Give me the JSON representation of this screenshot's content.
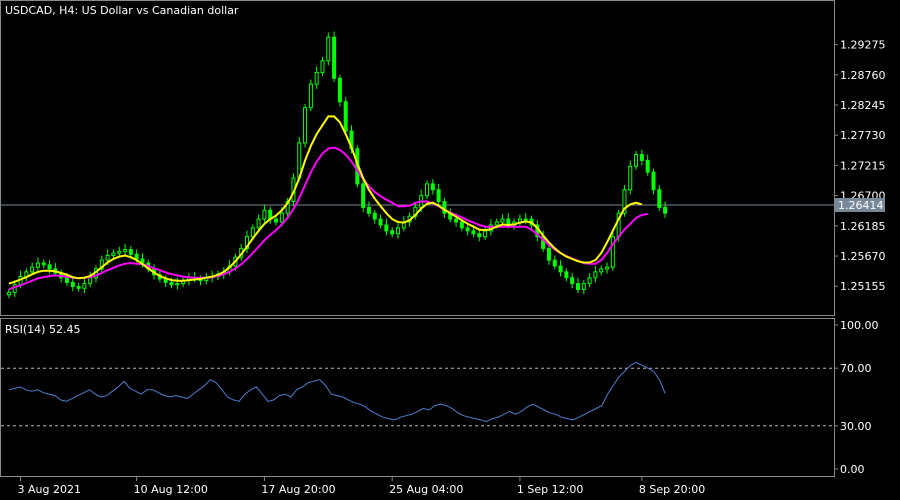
{
  "chart_data": [
    {
      "type": "candlestick",
      "title": "USDCAD, H4:  US Dollar vs Canadian dollar",
      "ylim": [
        1.2475,
        1.2995
      ],
      "y_ticks": [
        "1.29275",
        "1.28760",
        "1.28245",
        "1.27730",
        "1.27215",
        "1.26700",
        "1.26185",
        "1.25670",
        "1.25155"
      ],
      "current_price": "1.26414",
      "x_ticks": [
        "3 Aug 2021",
        "10 Aug 12:00",
        "17 Aug 20:00",
        "25 Aug 04:00",
        "1 Sep 12:00",
        "8 Sep 20:00"
      ],
      "colors": {
        "candle": "#00ff00",
        "ma_fast": "#ffff00",
        "ma_slow": "#ff00ff",
        "price_line": "#778899"
      },
      "closes": [
        1.2505,
        1.2518,
        1.2532,
        1.254,
        1.2548,
        1.2555,
        1.2552,
        1.2545,
        1.2538,
        1.253,
        1.2522,
        1.2515,
        1.2512,
        1.252,
        1.253,
        1.2545,
        1.256,
        1.2568,
        1.2572,
        1.2575,
        1.2578,
        1.257,
        1.2562,
        1.2555,
        1.2545,
        1.2535,
        1.2528,
        1.2522,
        1.2518,
        1.252,
        1.2525,
        1.253,
        1.2528,
        1.2525,
        1.253,
        1.2532,
        1.2536,
        1.254,
        1.255,
        1.2565,
        1.258,
        1.26,
        1.2615,
        1.263,
        1.2645,
        1.263,
        1.2625,
        1.264,
        1.266,
        1.27,
        1.276,
        1.282,
        1.286,
        1.288,
        1.29,
        1.294,
        1.287,
        1.283,
        1.278,
        1.275,
        1.269,
        1.265,
        1.264,
        1.263,
        1.262,
        1.261,
        1.2605,
        1.2615,
        1.2625,
        1.2635,
        1.265,
        1.267,
        1.269,
        1.268,
        1.266,
        1.264,
        1.263,
        1.2625,
        1.2615,
        1.261,
        1.2605,
        1.26,
        1.261,
        1.262,
        1.2625,
        1.263,
        1.262,
        1.2625,
        1.263,
        1.263,
        1.262,
        1.26,
        1.258,
        1.256,
        1.255,
        1.254,
        1.253,
        1.252,
        1.251,
        1.252,
        1.253,
        1.254,
        1.2545,
        1.2548,
        1.26,
        1.264,
        1.268,
        1.272,
        1.274,
        1.273,
        1.271,
        1.268,
        1.265,
        1.264
      ],
      "ma_fast": [
        1.252,
        1.2523,
        1.2527,
        1.2531,
        1.2536,
        1.254,
        1.2542,
        1.2542,
        1.2541,
        1.2538,
        1.2535,
        1.2531,
        1.2529,
        1.253,
        1.2533,
        1.254,
        1.2548,
        1.2556,
        1.2562,
        1.2566,
        1.2568,
        1.2565,
        1.256,
        1.2553,
        1.2546,
        1.2539,
        1.2533,
        1.2529,
        1.2526,
        1.2525,
        1.2525,
        1.2526,
        1.2527,
        1.2528,
        1.253,
        1.2532,
        1.2535,
        1.254,
        1.2548,
        1.2558,
        1.257,
        1.2583,
        1.2597,
        1.261,
        1.2622,
        1.263,
        1.2636,
        1.2645,
        1.2657,
        1.2675,
        1.27,
        1.273,
        1.2755,
        1.2775,
        1.279,
        1.2805,
        1.2805,
        1.2795,
        1.2775,
        1.2752,
        1.2725,
        1.27,
        1.268,
        1.2665,
        1.2652,
        1.264,
        1.263,
        1.2625,
        1.2624,
        1.2628,
        1.2637,
        1.2648,
        1.2656,
        1.2658,
        1.2653,
        1.2646,
        1.264,
        1.2634,
        1.2628,
        1.2622,
        1.2617,
        1.2612,
        1.2611,
        1.2613,
        1.2617,
        1.2621,
        1.262,
        1.2621,
        1.2624,
        1.2626,
        1.2624,
        1.2615,
        1.2602,
        1.259,
        1.258,
        1.2572,
        1.2566,
        1.2562,
        1.2558,
        1.2556,
        1.2556,
        1.256,
        1.2572,
        1.259,
        1.261,
        1.263,
        1.2648,
        1.2655,
        1.2658,
        1.2655
      ],
      "ma_slow": [
        1.251,
        1.2514,
        1.2517,
        1.2521,
        1.2525,
        1.2529,
        1.2531,
        1.2533,
        1.2534,
        1.2533,
        1.2532,
        1.253,
        1.2529,
        1.253,
        1.2531,
        1.2534,
        1.2538,
        1.2543,
        1.2547,
        1.2551,
        1.2554,
        1.2555,
        1.2554,
        1.2553,
        1.255,
        1.2546,
        1.2543,
        1.2539,
        1.2536,
        1.2534,
        1.2532,
        1.2531,
        1.253,
        1.253,
        1.253,
        1.2531,
        1.2533,
        1.2536,
        1.254,
        1.2546,
        1.2553,
        1.2562,
        1.2572,
        1.2583,
        1.2594,
        1.2603,
        1.2611,
        1.2621,
        1.2632,
        1.2647,
        1.2666,
        1.2688,
        1.271,
        1.2728,
        1.2742,
        1.275,
        1.2752,
        1.2748,
        1.274,
        1.2728,
        1.2713,
        1.2698,
        1.2686,
        1.2676,
        1.2669,
        1.2663,
        1.2658,
        1.2652,
        1.2652,
        1.2653,
        1.2658,
        1.266,
        1.266,
        1.2657,
        1.2652,
        1.2646,
        1.2641,
        1.2637,
        1.2633,
        1.2628,
        1.2624,
        1.262,
        1.2617,
        1.2617,
        1.2617,
        1.2617,
        1.2617,
        1.2617,
        1.2617,
        1.2617,
        1.2612,
        1.2604,
        1.2595,
        1.2586,
        1.2578,
        1.2572,
        1.2567,
        1.2563,
        1.2559,
        1.2555,
        1.2554,
        1.2554,
        1.256,
        1.2572,
        1.2587,
        1.26,
        1.2612,
        1.2622,
        1.2632,
        1.2637,
        1.2639
      ]
    },
    {
      "type": "line",
      "title": "RSI(14) 52.45",
      "ylim": [
        0,
        100
      ],
      "y_ticks": [
        "100.00",
        "70.00",
        "30.00",
        "0.00"
      ],
      "levels": [
        70,
        30
      ],
      "colors": {
        "rsi": "#4f7fd0",
        "level": "#b4b4b4"
      },
      "values": [
        55,
        56,
        57,
        55,
        54,
        55,
        53,
        52,
        51,
        48,
        47,
        49,
        51,
        53,
        55,
        52,
        50,
        51,
        54,
        57,
        61,
        56,
        54,
        52,
        55,
        55,
        53,
        51,
        50,
        51,
        50,
        49,
        52,
        55,
        58,
        62,
        60,
        55,
        50,
        48,
        47,
        52,
        55,
        57,
        52,
        47,
        48,
        51,
        52,
        50,
        55,
        57,
        60,
        61,
        62,
        58,
        52,
        51,
        50,
        48,
        46,
        45,
        43,
        40,
        38,
        36,
        35,
        34,
        36,
        37,
        38,
        40,
        42,
        41,
        44,
        45,
        44,
        42,
        39,
        37,
        36,
        35,
        34,
        33,
        35,
        36,
        38,
        40,
        38,
        40,
        43,
        45,
        43,
        41,
        39,
        38,
        36,
        35,
        34,
        36,
        38,
        40,
        42,
        44,
        52,
        58,
        64,
        68,
        72,
        74,
        72,
        70,
        68,
        62,
        52.45
      ]
    }
  ]
}
